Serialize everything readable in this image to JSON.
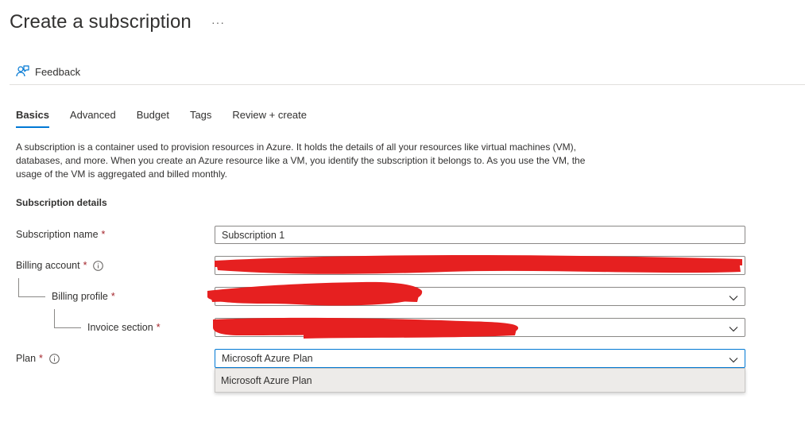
{
  "header": {
    "title": "Create a subscription",
    "more_label": "···"
  },
  "commands": {
    "feedback_label": "Feedback"
  },
  "tabs": [
    {
      "label": "Basics",
      "active": true
    },
    {
      "label": "Advanced",
      "active": false
    },
    {
      "label": "Budget",
      "active": false
    },
    {
      "label": "Tags",
      "active": false
    },
    {
      "label": "Review + create",
      "active": false
    }
  ],
  "description": "A subscription is a container used to provision resources in Azure. It holds the details of all your resources like virtual machines (VM), databases, and more. When you create an Azure resource like a VM, you identify the subscription it belongs to. As you use the VM, the usage of the VM is aggregated and billed monthly.",
  "section_title": "Subscription details",
  "fields": {
    "subscription_name": {
      "label": "Subscription name",
      "required": "*",
      "value": "Subscription 1"
    },
    "billing_account": {
      "label": "Billing account",
      "required": "*",
      "value": ""
    },
    "billing_profile": {
      "label": "Billing profile",
      "required": "*",
      "value": ""
    },
    "invoice_section": {
      "label": "Invoice section",
      "required": "*",
      "value": ""
    },
    "plan": {
      "label": "Plan",
      "required": "*",
      "value": "Microsoft Azure Plan"
    }
  },
  "plan_dropdown": {
    "options": [
      "Microsoft Azure Plan"
    ]
  },
  "colors": {
    "accent": "#0078d4",
    "required": "#a4262c",
    "redaction": "#e62020"
  }
}
